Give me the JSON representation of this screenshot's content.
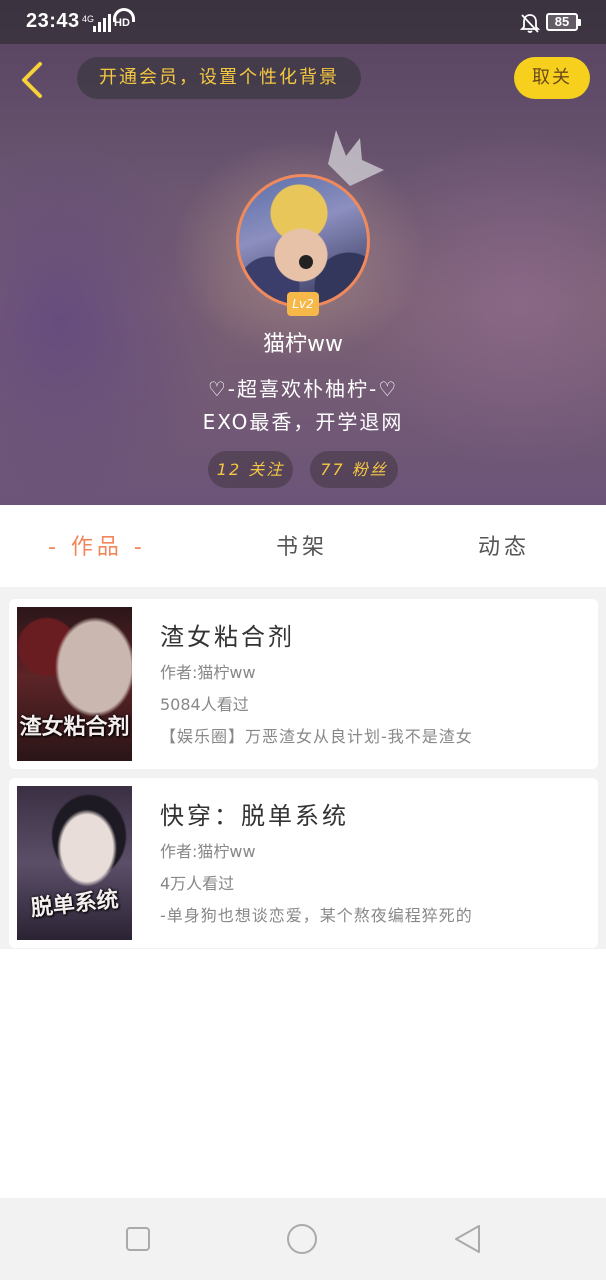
{
  "status_bar": {
    "time": "23:43",
    "network": "4G",
    "hd": "HD",
    "battery": "85"
  },
  "header": {
    "vip_banner": "开通会员，设置个性化背景",
    "cancel_label": "取关"
  },
  "profile": {
    "level": "Lv2",
    "username": "猫柠ww",
    "bio_line1": "♡-超喜欢朴柚柠-♡",
    "bio_line2": "EXO最香，开学退网",
    "following": "12 关注",
    "followers": "77 粉丝"
  },
  "tabs": {
    "works": "- 作品 -",
    "bookshelf": "书架",
    "feed": "动态"
  },
  "books": [
    {
      "title": "渣女粘合剂",
      "author": "作者:猫柠ww",
      "views": "5084人看过",
      "description": "【娱乐圈】万恶渣女从良计划-我不是渣女",
      "cover_title": "渣女粘合剂"
    },
    {
      "title": "快穿：脱单系统",
      "author": "作者:猫柠ww",
      "views": "4万人看过",
      "description": "-单身狗也想谈恋爱，某个熬夜编程猝死的",
      "cover_title": "脱单系统"
    }
  ],
  "colors": {
    "accent": "#f0875c",
    "vip_text": "#f5c842",
    "cancel_bg": "#f7cf1d"
  },
  "icons": {
    "back": "chevron-left-icon",
    "crown": "crown-icon",
    "mute": "bell-off-icon",
    "nav_recent": "square-icon",
    "nav_home": "circle-icon",
    "nav_back": "triangle-back-icon"
  }
}
